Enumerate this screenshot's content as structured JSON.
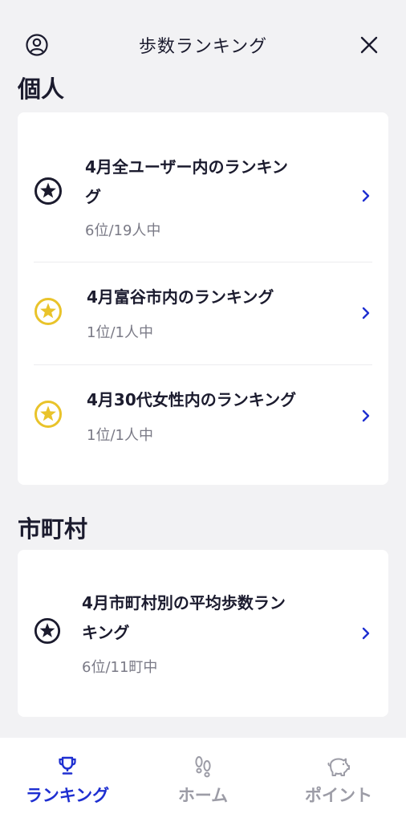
{
  "header": {
    "title": "歩数ランキング"
  },
  "sections": {
    "personal": {
      "title": "個人",
      "items": [
        {
          "name_line1": "4月全ユーザー内のランキン",
          "name_line2": "グ",
          "rank": "6位/19人中",
          "star": "dark"
        },
        {
          "name_line1": "4月富谷市内のランキング",
          "rank": "1位/1人中",
          "star": "gold"
        },
        {
          "name_line1": "4月30代女性内のランキング",
          "rank": "1位/1人中",
          "star": "gold"
        }
      ]
    },
    "municipal": {
      "title": "市町村",
      "items": [
        {
          "name_line1": "4月市町村別の平均歩数ラン",
          "name_line2": "キング",
          "rank": "6位/11町中",
          "star": "dark"
        }
      ]
    }
  },
  "tabs": [
    {
      "label": "ランキング",
      "icon": "trophy-icon",
      "active": true
    },
    {
      "label": "ホーム",
      "icon": "footprints-icon",
      "active": false
    },
    {
      "label": "ポイント",
      "icon": "piggy-bank-icon",
      "active": false
    }
  ],
  "colors": {
    "accent": "#1e2fd1",
    "star_dark": "#1b1b2e",
    "star_gold": "#e9c32a",
    "background": "#f2f2f4"
  }
}
